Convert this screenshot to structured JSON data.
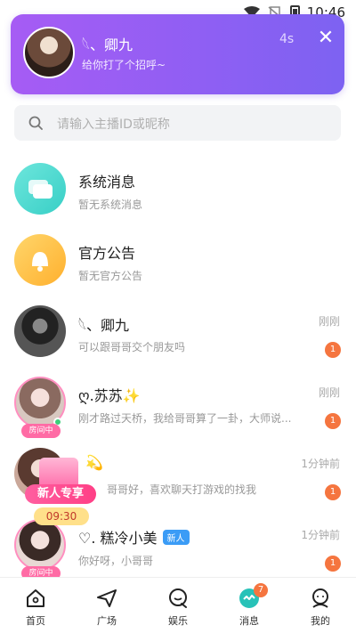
{
  "status_bar": {
    "time": "10:46"
  },
  "notification": {
    "name": "𓆩、卿九",
    "message": "给你打了个招呼~",
    "time": "4s",
    "close": "✕"
  },
  "search": {
    "placeholder": "请输入主播ID或昵称"
  },
  "conversations": [
    {
      "title": "系统消息",
      "subtitle": "暂无系统消息",
      "icon": "chat-bubbles-icon",
      "color": "#4fd9d0"
    },
    {
      "title": "官方公告",
      "subtitle": "暂无官方公告",
      "icon": "bell-icon",
      "color": "#ffbe3d"
    },
    {
      "title": "𓆩、卿九",
      "subtitle": "可以跟哥哥交个朋友吗",
      "time": "刚刚",
      "unread": "1"
    },
    {
      "title": "ღ.苏苏✨",
      "subtitle": "刚才路过天桥，我给哥哥算了一卦，大师说...",
      "time": "刚刚",
      "unread": "1",
      "live_tag": "房间中"
    },
    {
      "title": "💫",
      "subtitle": "哥哥好，喜欢聊天打游戏的找我",
      "time": "1分钟前",
      "unread": "1"
    },
    {
      "title": "♡. 糕冷小美",
      "badge": "新人",
      "subtitle": "你好呀，小哥哥",
      "time": "1分钟前",
      "unread": "1",
      "live_tag": "房间中"
    }
  ],
  "promo": {
    "label": "新人专享",
    "timer": "09:30"
  },
  "tabs": [
    {
      "label": "首页",
      "icon": "home-icon"
    },
    {
      "label": "广场",
      "icon": "plane-icon"
    },
    {
      "label": "娱乐",
      "icon": "chat-q-icon"
    },
    {
      "label": "消息",
      "icon": "message-icon",
      "badge": "7",
      "color": "#28c2b8"
    },
    {
      "label": "我的",
      "icon": "profile-icon"
    }
  ]
}
